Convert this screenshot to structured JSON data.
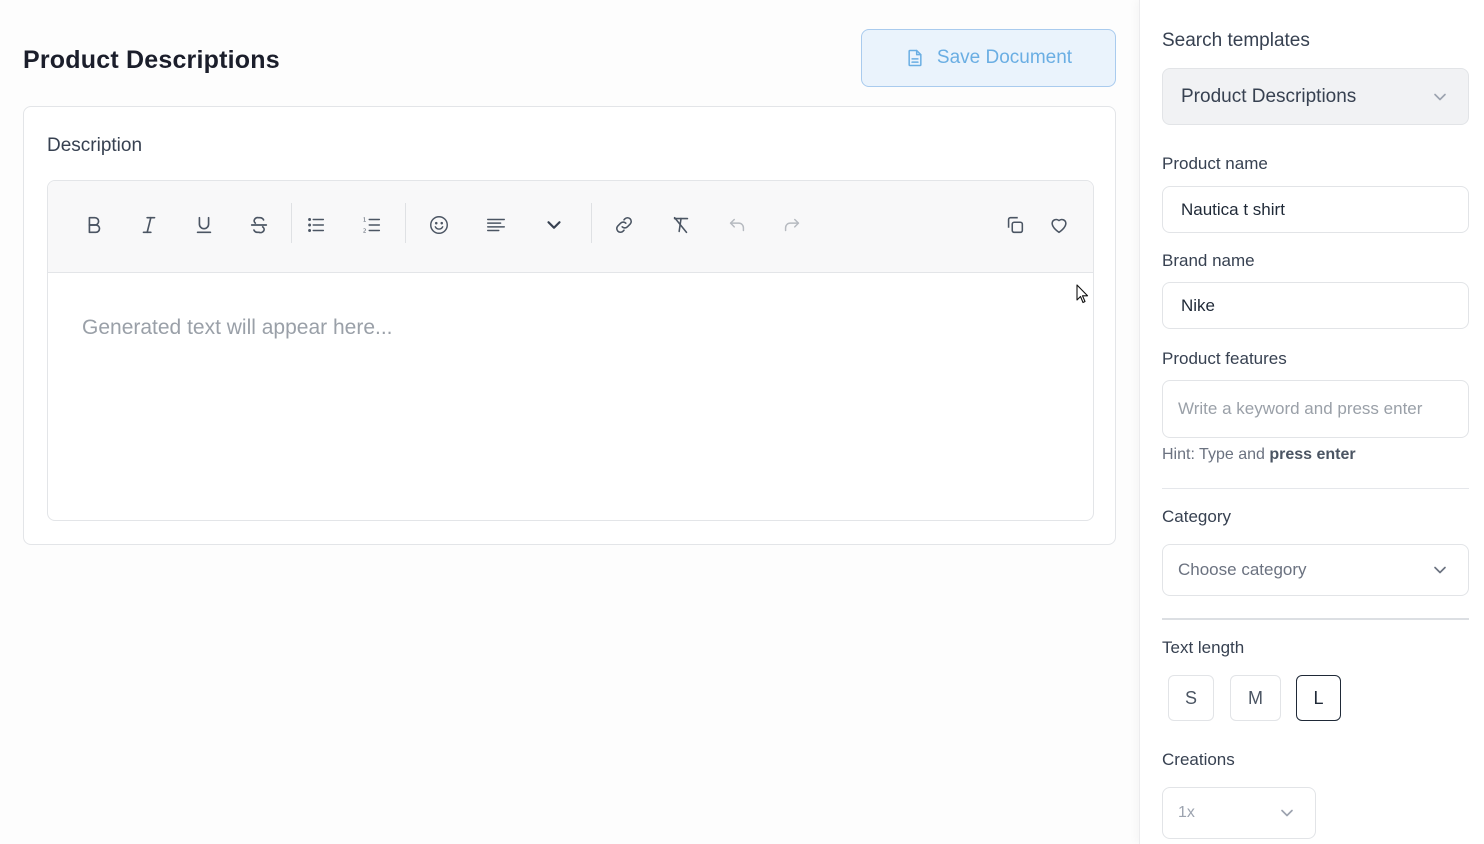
{
  "main": {
    "title": "Product Descriptions",
    "save_label": "Save Document",
    "card_label": "Description",
    "editor_placeholder": "Generated text will appear here..."
  },
  "toolbar": {
    "icons": [
      "bold-icon",
      "italic-icon",
      "underline-icon",
      "strikethrough-icon",
      "bullet-list-icon",
      "numbered-list-icon",
      "emoji-icon",
      "align-icon",
      "chevron-down-icon",
      "link-icon",
      "clear-format-icon",
      "undo-icon",
      "redo-icon",
      "copy-icon",
      "heart-icon"
    ]
  },
  "panel": {
    "search_label": "Search templates",
    "template_value": "Product Descriptions",
    "product_name_label": "Product name",
    "product_name_value": "Nautica t shirt",
    "brand_name_label": "Brand name",
    "brand_name_value": "Nike",
    "features_label": "Product features",
    "features_placeholder": "Write a keyword and press enter",
    "hint_prefix": "Hint: Type and ",
    "hint_bold": "press enter",
    "category_label": "Category",
    "category_placeholder": "Choose category",
    "text_length_label": "Text length",
    "sizes": [
      "S",
      "M",
      "L"
    ],
    "active_size": "L",
    "creations_label": "Creations",
    "creations_value": "1x"
  },
  "colors": {
    "accent_light": "#eaf3fc",
    "accent_text": "#6aaee3",
    "border": "#e2e4e7"
  }
}
